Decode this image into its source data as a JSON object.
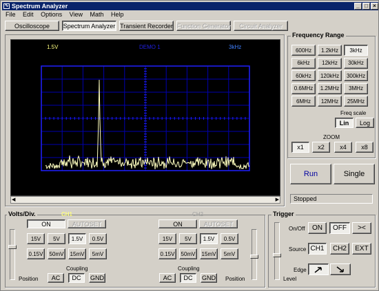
{
  "window": {
    "title": "Spectrum Analyzer"
  },
  "menu": [
    "File",
    "Edit",
    "Options",
    "View",
    "Math",
    "Help"
  ],
  "toolbar": {
    "tabs": [
      "Oscilloscope",
      "Spectrum Analyzer",
      "Transient Recorder",
      "Function Generator",
      "Circuit Analyzer"
    ],
    "active": "Spectrum Analyzer"
  },
  "scope": {
    "top_left": "1.5V",
    "top_center": "DEMO 1",
    "top_right": "3kHz"
  },
  "frequency_range": {
    "title": "Frequency Range",
    "options": [
      "600Hz",
      "1.2kHz",
      "3kHz",
      "6kHz",
      "12kHz",
      "30kHz",
      "60kHz",
      "120kHz",
      "300kHz",
      "0.6MHz",
      "1.2MHz",
      "3MHz",
      "6MHz",
      "12MHz",
      "25MHz"
    ],
    "selected": "3kHz",
    "freq_scale_label": "Freq scale",
    "lin": "Lin",
    "log": "Log",
    "zoom_label": "ZOOM",
    "zoom": [
      "x1",
      "x2",
      "x4",
      "x8"
    ]
  },
  "actions": {
    "run": "Run",
    "single": "Single"
  },
  "status": "Stopped",
  "volts": {
    "title": "Volts/Div.",
    "ch1": {
      "label": "CH1",
      "on": "ON",
      "autoset": "AUTOSET"
    },
    "ch2": {
      "label": "CH2",
      "on": "ON",
      "autoset": "AUTOSET"
    },
    "values": [
      "15V",
      "5V",
      "1.5V",
      "0.5V",
      "0.15V",
      "50mV",
      "15mV",
      "5mV"
    ],
    "selected": "1.5V",
    "coupling_label": "Coupling",
    "coupling": [
      "AC",
      "DC",
      "GND"
    ],
    "coupling_selected": "DC",
    "position_label": "Position"
  },
  "trigger": {
    "title": "Trigger",
    "onoff_label": "On/Off",
    "on": "ON",
    "off": "OFF",
    "split": "><",
    "source_label": "Source",
    "sources": [
      "CH1",
      "CH2",
      "EXT"
    ],
    "edge_label": "Edge",
    "level_label": "Level"
  },
  "colors": {
    "titlebar": "#0a246a",
    "scope_bg": "#000000",
    "grid": "#0000c8",
    "trace": "#ffffc0",
    "ch1_label": "#ffff80"
  }
}
